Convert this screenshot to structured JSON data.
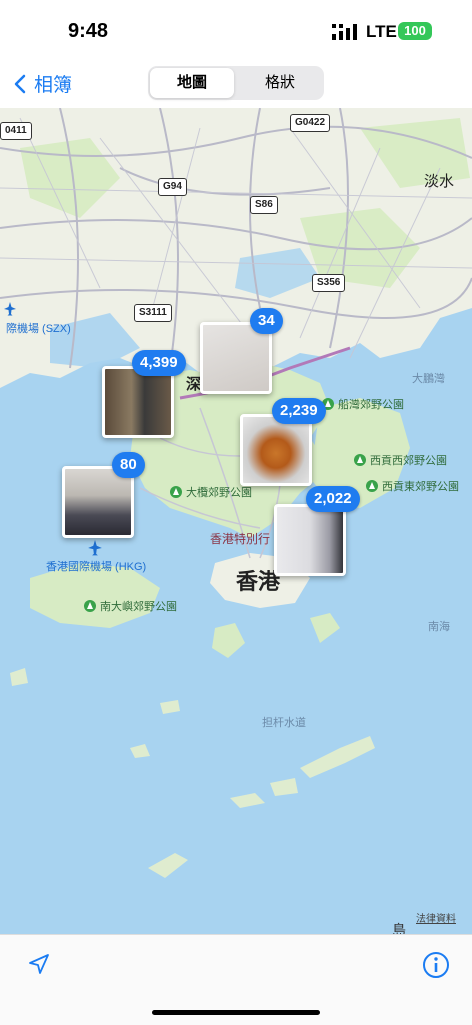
{
  "status": {
    "time": "9:48",
    "network": "LTE",
    "battery": "100"
  },
  "nav": {
    "back_label": "相簿",
    "segments": [
      "地圖",
      "格狀"
    ],
    "selected": "地圖"
  },
  "map": {
    "roads": [
      "G0422",
      "G94",
      "S86",
      "S3111",
      "S356",
      "0411"
    ],
    "places": {
      "tamsui": "淡水",
      "szx": "際機場 (SZX)",
      "shen": "深",
      "hongkong": "香港",
      "sar": "香港特別行",
      "hkg": "香港國際機場 (HKG)",
      "dapeng": "大鵬灣",
      "nanhai": "南海",
      "channel": "担杆水道",
      "cheung_chau": "島"
    },
    "parks": [
      "船灣郊野公園",
      "西貢西郊野公園",
      "西貢東郊野公園",
      "大欖郊野公園",
      "南大嶼郊野公園"
    ],
    "clusters": [
      {
        "count": "4,399"
      },
      {
        "count": "34"
      },
      {
        "count": "2,239"
      },
      {
        "count": "80"
      },
      {
        "count": "2,022"
      }
    ],
    "legal": "法律資料"
  },
  "toolbar": {
    "location_icon": "location-arrow-icon",
    "info_icon": "info-icon"
  },
  "colors": {
    "accent": "#1f7cf0",
    "water": "#a8d3f0",
    "land": "#eef0e6",
    "park": "#cfe8b8"
  }
}
